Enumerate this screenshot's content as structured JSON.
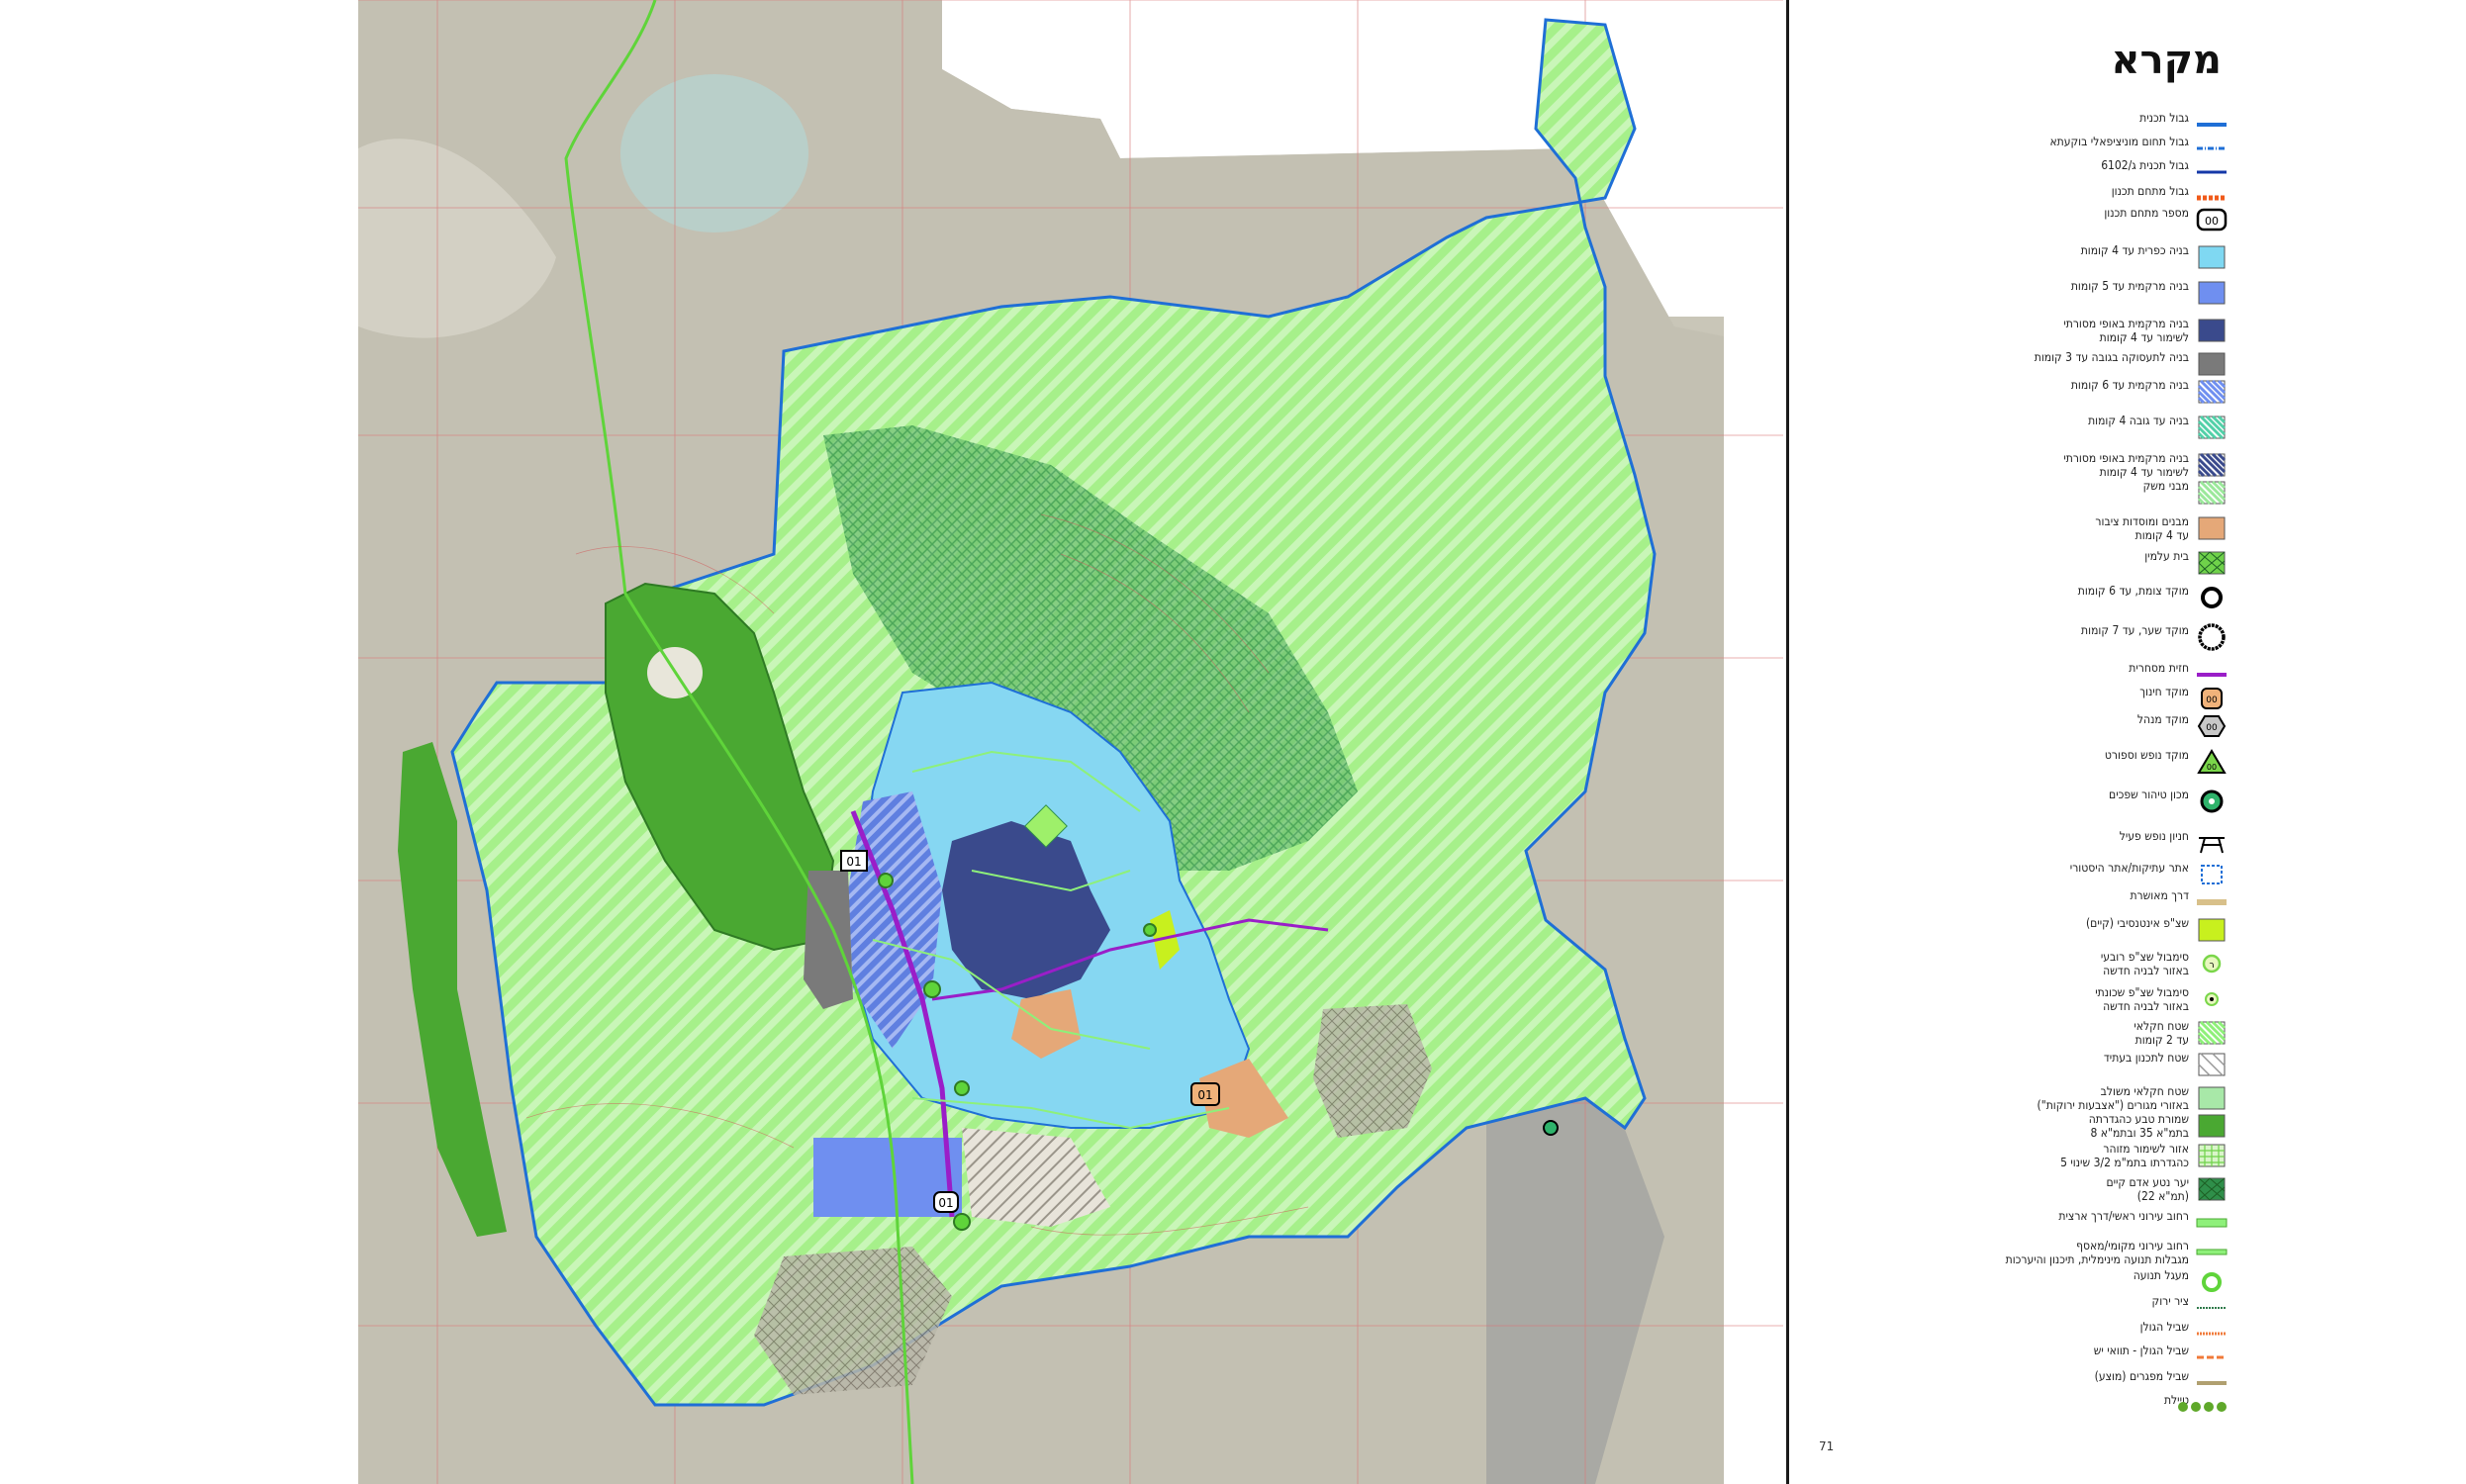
{
  "map": {
    "labels": {
      "route_number": "01",
      "zone_marker_a": "01",
      "zone_marker_b": "01",
      "zone_marker_c": "01"
    }
  },
  "legend": {
    "title": "מקרא",
    "items": [
      {
        "label": "גבול תכנית",
        "icon": "plan-boundary-line",
        "color": "#1f6fd6"
      },
      {
        "label": "גבול תחום מוניציפאלי בוקעתא",
        "icon": "municipal-boundary-line",
        "color": "#1f6fd6"
      },
      {
        "label": "גבול תכנית ג/6102",
        "icon": "plan-boundary-line-thin",
        "color": "#1438a8"
      },
      {
        "label": "גבול מתחם תכנון",
        "icon": "planning-zone-dashed-line",
        "color": "#f05a1a"
      },
      {
        "label": "מספר מתחם תכנון",
        "icon": "zone-number-box",
        "color": "#000000"
      },
      {
        "label": "בניה כפרית עד 4 קומות",
        "icon": "swatch",
        "color": "#7fd8f2"
      },
      {
        "label": "בניה מרקמית עד 5 קומות",
        "icon": "swatch",
        "color": "#6f8ff0"
      },
      {
        "label": "בניה מרקמית באופי מסורתי\nלשימור עד 4 קומות",
        "icon": "swatch",
        "color": "#3a4a8c"
      },
      {
        "label": "בניה לתעסוקה בגובה עד 3 קומות",
        "icon": "swatch",
        "color": "#7a7a7a"
      },
      {
        "label": "בניה מרקמית עד 6 קומות",
        "icon": "hatched-swatch",
        "color": "#6f8ff0"
      },
      {
        "label": "בניה עד גובה 4 קומות",
        "icon": "hatched-swatch",
        "color": "#52d0a8"
      },
      {
        "label": "בניה מרקמית באופי מסורתי\nלשימור עד 4 קומות",
        "icon": "hatched-swatch",
        "color": "#3a4a8c"
      },
      {
        "label": "מבני משק",
        "icon": "hatched-swatch",
        "color": "#9be89b"
      },
      {
        "label": "מבנים ומוסדות ציבור\nעד 4 קומות",
        "icon": "swatch",
        "color": "#e5a878"
      },
      {
        "label": "בית עלמין",
        "icon": "cross-hatched-swatch",
        "color": "#6fd24a"
      },
      {
        "label": "מוקד צומת, עד 6 קומות",
        "icon": "ring-icon",
        "color": "#000000"
      },
      {
        "label": "מוקד שער, עד 7 קומות",
        "icon": "big-ring-icon",
        "color": "#000000"
      },
      {
        "label": "חזית מסחרית",
        "icon": "purple-line",
        "color": "#9a1ec8"
      },
      {
        "label": "מוקד חינוך",
        "icon": "education-hub-icon",
        "color": "#f0b27a"
      },
      {
        "label": "מוקד מנהל",
        "icon": "hexagon-icon",
        "color": "#c8c8c8"
      },
      {
        "label": "מוקד נופש וספורט",
        "icon": "triangle-icon",
        "color": "#7ad64a"
      },
      {
        "label": "מכון טיהור שפכים",
        "icon": "sewage-plant-icon",
        "color": "#2fb36b"
      },
      {
        "label": "חניון נופש פעיל",
        "icon": "picnic-table-icon",
        "color": "#000000"
      },
      {
        "label": "אתר עתיקות/אתר היסטורי",
        "icon": "dashed-square-icon",
        "color": "#1f6fd6"
      },
      {
        "label": "דרך מאושרת",
        "icon": "approved-road-line",
        "color": "#d8c08a"
      },
      {
        "label": "שצ\"פ אינטנסיבי (קיים)",
        "icon": "swatch",
        "color": "#c8f01e"
      },
      {
        "label": "סימבול שצ\"פ רובעי\nבאזור לבניה חדשה",
        "icon": "district-park-icon",
        "color": "#7ad64a"
      },
      {
        "label": "סימבול שצ\"פ שכונתי\nבאזור לבניה חדשה",
        "icon": "neighbourhood-park-icon",
        "color": "#7ad64a"
      },
      {
        "label": "שטח חקלאי\nעד 2 קומות",
        "icon": "hatched-swatch",
        "color": "#8ef07a"
      },
      {
        "label": "שטח לתכנון בעתיד",
        "icon": "grey-hatched-swatch",
        "color": "#999999"
      },
      {
        "label": "שטח חקלאי משולב\nבאזורי מגורים (\"אצבעות ירוקות\")",
        "icon": "dotted-swatch",
        "color": "#a8e8a8"
      },
      {
        "label": "שמורת טבע כהגדרתה\nבתמ\"א 35 ובתמ\"א 8",
        "icon": "swatch",
        "color": "#4aa832"
      },
      {
        "label": "אזור לשימור מזוהר\nכהגדרתו בתמ\"מ 3/2 שינוי 5",
        "icon": "grid-swatch",
        "color": "#6fd24a"
      },
      {
        "label": "יער נטע אדם קיים\n(תמ\"א 22)",
        "icon": "cross-hatched-swatch",
        "color": "#2f8f4a"
      },
      {
        "label": "רחוב עירוני ראשי/דרך ארצית",
        "icon": "main-street-line",
        "color": "#8ef07a"
      },
      {
        "label": "רחוב עירוני מקומי/מאסף\nמגבלות תנועה מינימלית, תיכנון והיערכות",
        "icon": "local-street-line",
        "color": "#8ef07a"
      },
      {
        "label": "מעגל תנועה",
        "icon": "roundabout-icon",
        "color": "#5fd43a"
      },
      {
        "label": "ציר ירוק",
        "icon": "green-axis-line",
        "color": "#2f7a4a"
      },
      {
        "label": "שביל הגולן",
        "icon": "golan-trail-line",
        "color": "#f07a3a"
      },
      {
        "label": "שביל הגולן - תוואי יש",
        "icon": "golan-trail-existing-line",
        "color": "#f07a3a"
      },
      {
        "label": "שביל מפגרים (מוצע)",
        "icon": "proposed-trail-line",
        "color": "#b0a070"
      },
      {
        "label": "טיילת",
        "icon": "promenade-icon",
        "color": "#5fa82a"
      }
    ],
    "page_number": "71"
  }
}
